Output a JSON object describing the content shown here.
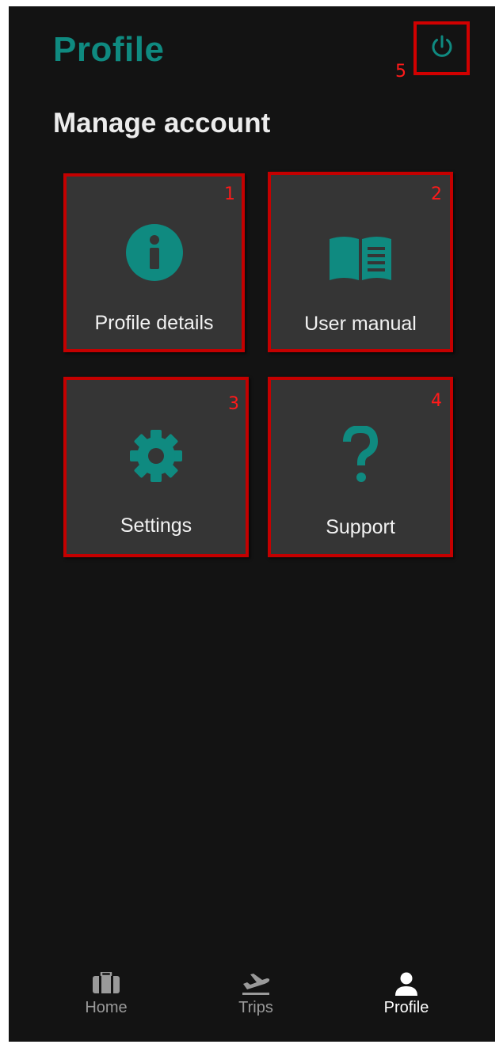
{
  "header": {
    "title": "Profile",
    "power_icon": "power-icon",
    "power_marker": "5"
  },
  "section": {
    "title": "Manage account"
  },
  "tiles": [
    {
      "label": "Profile details",
      "icon": "info-icon",
      "marker": "1"
    },
    {
      "label": "User manual",
      "icon": "book-icon",
      "marker": "2"
    },
    {
      "label": "Settings",
      "icon": "gear-icon",
      "marker": "3"
    },
    {
      "label": "Support",
      "icon": "question-icon",
      "marker": "4"
    }
  ],
  "bottom_nav": {
    "items": [
      {
        "label": "Home",
        "icon": "briefcase-icon",
        "active": false
      },
      {
        "label": "Trips",
        "icon": "airplane-takeoff-icon",
        "active": false
      },
      {
        "label": "Profile",
        "icon": "person-icon",
        "active": true
      }
    ]
  },
  "colors": {
    "accent": "#0f8a80",
    "background": "#131313",
    "tile": "#353535",
    "annotation": "#d10000"
  }
}
